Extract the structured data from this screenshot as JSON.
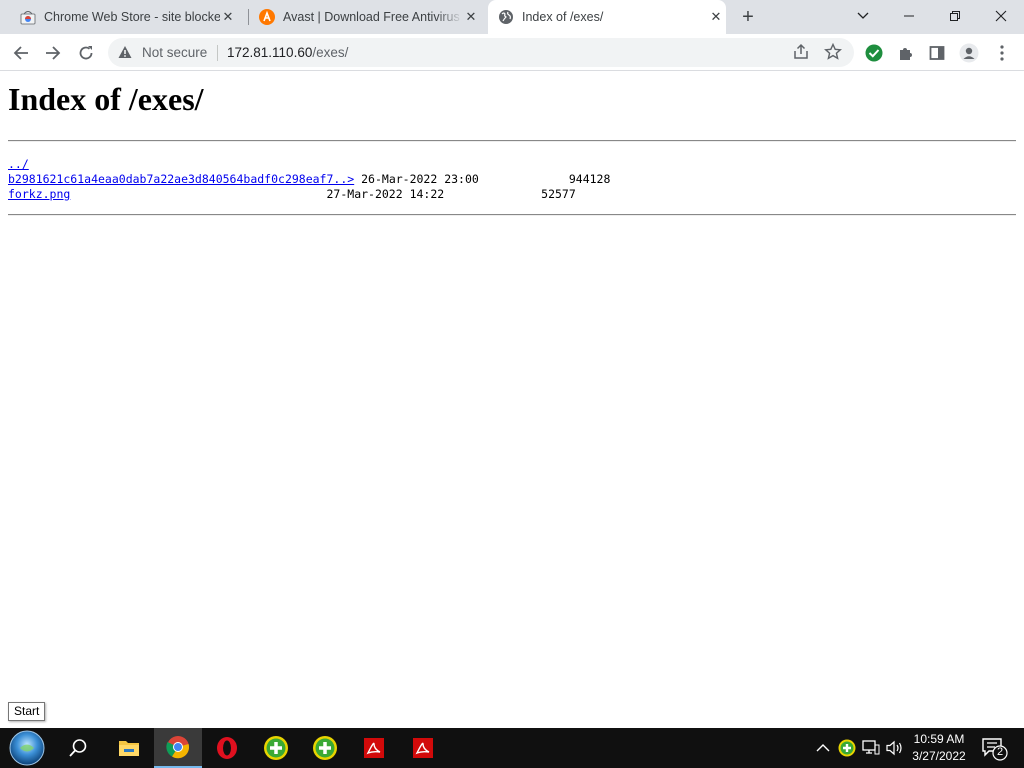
{
  "tabs": [
    {
      "title": "Chrome Web Store - site blocker",
      "icon": "chrome-web-store-icon",
      "active": false
    },
    {
      "title": "Avast | Download Free Antivirus & VPN",
      "icon": "avast-icon",
      "active": false
    },
    {
      "title": "Index of /exes/",
      "icon": "globe-icon",
      "active": true
    }
  ],
  "toolbar": {
    "security_label": "Not secure",
    "url_host": "172.81.110.60",
    "url_path": "/exes/"
  },
  "page": {
    "heading": "Index of /exes/",
    "parent_link": "../",
    "files": [
      {
        "name": "b2981621c61a4eaa0dab7a22ae3d840564badf0c298eaf7..>",
        "date": "26-Mar-2022 23:00",
        "size": "944128"
      },
      {
        "name": "forkz.png",
        "date": "27-Mar-2022 14:22",
        "size": "52577"
      }
    ]
  },
  "tooltip": "Start",
  "taskbar": {
    "time": "10:59 AM",
    "date": "3/27/2022",
    "notification_count": "2",
    "apps": [
      "start-orb-icon",
      "search-icon",
      "file-explorer-icon",
      "chrome-icon",
      "opera-icon",
      "green-plus-app-icon",
      "green-plus-app-icon",
      "pdf-reader-icon",
      "pdf-reader-icon"
    ]
  },
  "colors": {
    "link": "#0000ee",
    "taskbar": "#101010",
    "tabstrip": "#dee1e6",
    "secure_check": "#1e8e3e"
  }
}
